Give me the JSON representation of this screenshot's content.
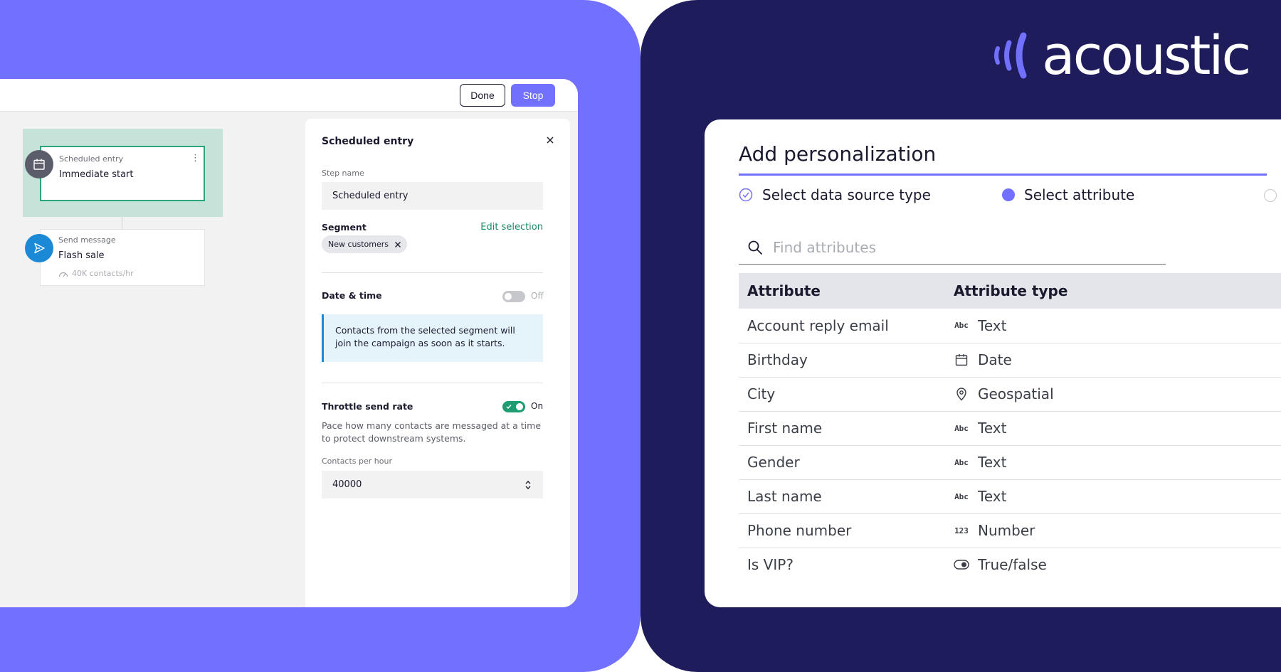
{
  "brand": {
    "name": "acoustic"
  },
  "campaign": {
    "done_label": "Done",
    "stop_label": "Stop",
    "flow": {
      "entry": {
        "type_label": "Scheduled entry",
        "title": "Immediate start"
      },
      "message": {
        "type_label": "Send message",
        "title": "Flash sale",
        "rate": "40K contacts/hr"
      }
    },
    "panel": {
      "title": "Scheduled entry",
      "step_name_label": "Step name",
      "step_name_value": "Scheduled entry",
      "segment_heading": "Segment",
      "edit_selection": "Edit selection",
      "segment_chip": "New customers",
      "datetime_heading": "Date & time",
      "datetime_toggle": "Off",
      "info_text": "Contacts from the selected segment will join the campaign as soon as it starts.",
      "throttle_heading": "Throttle send rate",
      "throttle_toggle": "On",
      "throttle_desc": "Pace how many contacts are messaged at a time to protect downstream systems.",
      "contacts_label": "Contacts per hour",
      "contacts_value": "40000"
    }
  },
  "personalization": {
    "title": "Add personalization",
    "steps": [
      {
        "label": "Select data source type",
        "state": "complete"
      },
      {
        "label": "Select attribute",
        "state": "current"
      },
      {
        "label": "",
        "state": "pending"
      }
    ],
    "search_placeholder": "Find attributes",
    "columns": [
      "Attribute",
      "Attribute type"
    ],
    "rows": [
      {
        "attribute": "Account reply email",
        "type": "Text",
        "icon": "text-icon"
      },
      {
        "attribute": "Birthday",
        "type": "Date",
        "icon": "calendar-icon"
      },
      {
        "attribute": "City",
        "type": "Geospatial",
        "icon": "location-pin-icon"
      },
      {
        "attribute": "First name",
        "type": "Text",
        "icon": "text-icon"
      },
      {
        "attribute": "Gender",
        "type": "Text",
        "icon": "text-icon"
      },
      {
        "attribute": "Last name",
        "type": "Text",
        "icon": "text-icon"
      },
      {
        "attribute": "Phone number",
        "type": "Number",
        "icon": "number-icon"
      },
      {
        "attribute": "Is VIP?",
        "type": "True/false",
        "icon": "toggle-icon"
      }
    ]
  },
  "colors": {
    "purple": "#7270ff",
    "navy": "#1f1c5c",
    "green": "#1f9d72",
    "blue": "#1b89d6"
  }
}
